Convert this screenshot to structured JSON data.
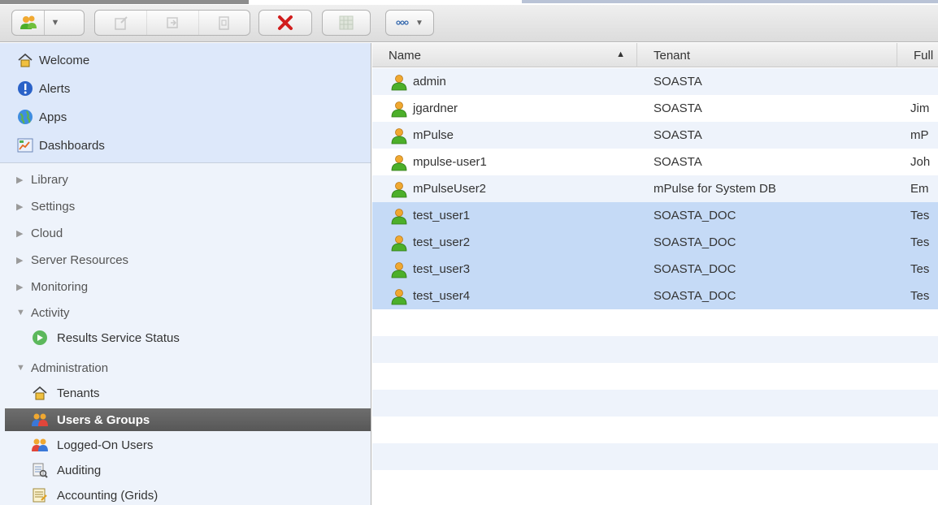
{
  "toolbar": {
    "buttons": [
      {
        "icon": "users-add-icon"
      },
      {
        "icon": "chevron-down-icon"
      },
      {
        "icon": "edit-icon"
      },
      {
        "icon": "copy-icon"
      },
      {
        "icon": "paste-icon"
      },
      {
        "icon": "delete-icon"
      },
      {
        "icon": "grid-icon"
      },
      {
        "icon": "more-options-icon"
      }
    ]
  },
  "sidebar": {
    "top_items": [
      {
        "label": "Welcome",
        "icon": "home-icon"
      },
      {
        "label": "Alerts",
        "icon": "alert-icon"
      },
      {
        "label": "Apps",
        "icon": "globe-icon"
      },
      {
        "label": "Dashboards",
        "icon": "dashboard-icon"
      }
    ],
    "sections": [
      {
        "label": "Library",
        "expanded": false
      },
      {
        "label": "Settings",
        "expanded": false
      },
      {
        "label": "Cloud",
        "expanded": false
      },
      {
        "label": "Server Resources",
        "expanded": false
      },
      {
        "label": "Monitoring",
        "expanded": false
      },
      {
        "label": "Activity",
        "expanded": true
      },
      {
        "label": "Administration",
        "expanded": true
      }
    ],
    "activity_items": [
      {
        "label": "Results Service Status",
        "icon": "status-icon"
      }
    ],
    "admin_items": [
      {
        "label": "Tenants",
        "icon": "home-icon"
      },
      {
        "label": "Users & Groups",
        "icon": "users-groups-icon",
        "selected": true
      },
      {
        "label": "Logged-On Users",
        "icon": "logged-users-icon"
      },
      {
        "label": "Auditing",
        "icon": "auditing-icon"
      },
      {
        "label": "Accounting (Grids)",
        "icon": "accounting-icon"
      }
    ]
  },
  "table": {
    "columns": [
      "Name",
      "Tenant",
      "Full"
    ],
    "sort_column": "Name",
    "sort_direction": "ascending",
    "rows": [
      {
        "name": "admin",
        "tenant": "SOASTA",
        "full": "",
        "selected": false
      },
      {
        "name": "jgardner",
        "tenant": "SOASTA",
        "full": "Jim",
        "selected": false
      },
      {
        "name": "mPulse",
        "tenant": "SOASTA",
        "full": "mP",
        "selected": false
      },
      {
        "name": "mpulse-user1",
        "tenant": "SOASTA",
        "full": "Joh",
        "selected": false
      },
      {
        "name": "mPulseUser2",
        "tenant": "mPulse for System DB",
        "full": "Em",
        "selected": false
      },
      {
        "name": "test_user1",
        "tenant": "SOASTA_DOC",
        "full": "Tes",
        "selected": true
      },
      {
        "name": "test_user2",
        "tenant": "SOASTA_DOC",
        "full": "Tes",
        "selected": true
      },
      {
        "name": "test_user3",
        "tenant": "SOASTA_DOC",
        "full": "Tes",
        "selected": true
      },
      {
        "name": "test_user4",
        "tenant": "SOASTA_DOC",
        "full": "Tes",
        "selected": true
      }
    ]
  },
  "colors": {
    "selection": "#c5daf6",
    "sidebar_bg": "#eef3fb",
    "sidebar_top_bg": "#dde8fa",
    "selected_nav": "#5f5f5f"
  }
}
